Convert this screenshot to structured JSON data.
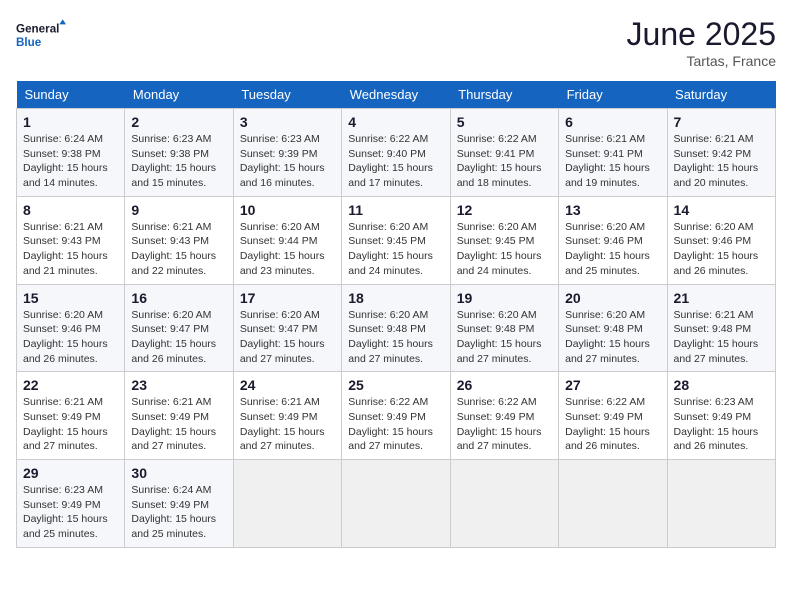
{
  "header": {
    "logo_line1": "General",
    "logo_line2": "Blue",
    "month_year": "June 2025",
    "location": "Tartas, France"
  },
  "weekdays": [
    "Sunday",
    "Monday",
    "Tuesday",
    "Wednesday",
    "Thursday",
    "Friday",
    "Saturday"
  ],
  "weeks": [
    [
      {
        "day": "1",
        "info": "Sunrise: 6:24 AM\nSunset: 9:38 PM\nDaylight: 15 hours and 14 minutes."
      },
      {
        "day": "2",
        "info": "Sunrise: 6:23 AM\nSunset: 9:38 PM\nDaylight: 15 hours and 15 minutes."
      },
      {
        "day": "3",
        "info": "Sunrise: 6:23 AM\nSunset: 9:39 PM\nDaylight: 15 hours and 16 minutes."
      },
      {
        "day": "4",
        "info": "Sunrise: 6:22 AM\nSunset: 9:40 PM\nDaylight: 15 hours and 17 minutes."
      },
      {
        "day": "5",
        "info": "Sunrise: 6:22 AM\nSunset: 9:41 PM\nDaylight: 15 hours and 18 minutes."
      },
      {
        "day": "6",
        "info": "Sunrise: 6:21 AM\nSunset: 9:41 PM\nDaylight: 15 hours and 19 minutes."
      },
      {
        "day": "7",
        "info": "Sunrise: 6:21 AM\nSunset: 9:42 PM\nDaylight: 15 hours and 20 minutes."
      }
    ],
    [
      {
        "day": "8",
        "info": "Sunrise: 6:21 AM\nSunset: 9:43 PM\nDaylight: 15 hours and 21 minutes."
      },
      {
        "day": "9",
        "info": "Sunrise: 6:21 AM\nSunset: 9:43 PM\nDaylight: 15 hours and 22 minutes."
      },
      {
        "day": "10",
        "info": "Sunrise: 6:20 AM\nSunset: 9:44 PM\nDaylight: 15 hours and 23 minutes."
      },
      {
        "day": "11",
        "info": "Sunrise: 6:20 AM\nSunset: 9:45 PM\nDaylight: 15 hours and 24 minutes."
      },
      {
        "day": "12",
        "info": "Sunrise: 6:20 AM\nSunset: 9:45 PM\nDaylight: 15 hours and 24 minutes."
      },
      {
        "day": "13",
        "info": "Sunrise: 6:20 AM\nSunset: 9:46 PM\nDaylight: 15 hours and 25 minutes."
      },
      {
        "day": "14",
        "info": "Sunrise: 6:20 AM\nSunset: 9:46 PM\nDaylight: 15 hours and 26 minutes."
      }
    ],
    [
      {
        "day": "15",
        "info": "Sunrise: 6:20 AM\nSunset: 9:46 PM\nDaylight: 15 hours and 26 minutes."
      },
      {
        "day": "16",
        "info": "Sunrise: 6:20 AM\nSunset: 9:47 PM\nDaylight: 15 hours and 26 minutes."
      },
      {
        "day": "17",
        "info": "Sunrise: 6:20 AM\nSunset: 9:47 PM\nDaylight: 15 hours and 27 minutes."
      },
      {
        "day": "18",
        "info": "Sunrise: 6:20 AM\nSunset: 9:48 PM\nDaylight: 15 hours and 27 minutes."
      },
      {
        "day": "19",
        "info": "Sunrise: 6:20 AM\nSunset: 9:48 PM\nDaylight: 15 hours and 27 minutes."
      },
      {
        "day": "20",
        "info": "Sunrise: 6:20 AM\nSunset: 9:48 PM\nDaylight: 15 hours and 27 minutes."
      },
      {
        "day": "21",
        "info": "Sunrise: 6:21 AM\nSunset: 9:48 PM\nDaylight: 15 hours and 27 minutes."
      }
    ],
    [
      {
        "day": "22",
        "info": "Sunrise: 6:21 AM\nSunset: 9:49 PM\nDaylight: 15 hours and 27 minutes."
      },
      {
        "day": "23",
        "info": "Sunrise: 6:21 AM\nSunset: 9:49 PM\nDaylight: 15 hours and 27 minutes."
      },
      {
        "day": "24",
        "info": "Sunrise: 6:21 AM\nSunset: 9:49 PM\nDaylight: 15 hours and 27 minutes."
      },
      {
        "day": "25",
        "info": "Sunrise: 6:22 AM\nSunset: 9:49 PM\nDaylight: 15 hours and 27 minutes."
      },
      {
        "day": "26",
        "info": "Sunrise: 6:22 AM\nSunset: 9:49 PM\nDaylight: 15 hours and 27 minutes."
      },
      {
        "day": "27",
        "info": "Sunrise: 6:22 AM\nSunset: 9:49 PM\nDaylight: 15 hours and 26 minutes."
      },
      {
        "day": "28",
        "info": "Sunrise: 6:23 AM\nSunset: 9:49 PM\nDaylight: 15 hours and 26 minutes."
      }
    ],
    [
      {
        "day": "29",
        "info": "Sunrise: 6:23 AM\nSunset: 9:49 PM\nDaylight: 15 hours and 25 minutes."
      },
      {
        "day": "30",
        "info": "Sunrise: 6:24 AM\nSunset: 9:49 PM\nDaylight: 15 hours and 25 minutes."
      },
      {
        "day": "",
        "info": ""
      },
      {
        "day": "",
        "info": ""
      },
      {
        "day": "",
        "info": ""
      },
      {
        "day": "",
        "info": ""
      },
      {
        "day": "",
        "info": ""
      }
    ]
  ]
}
